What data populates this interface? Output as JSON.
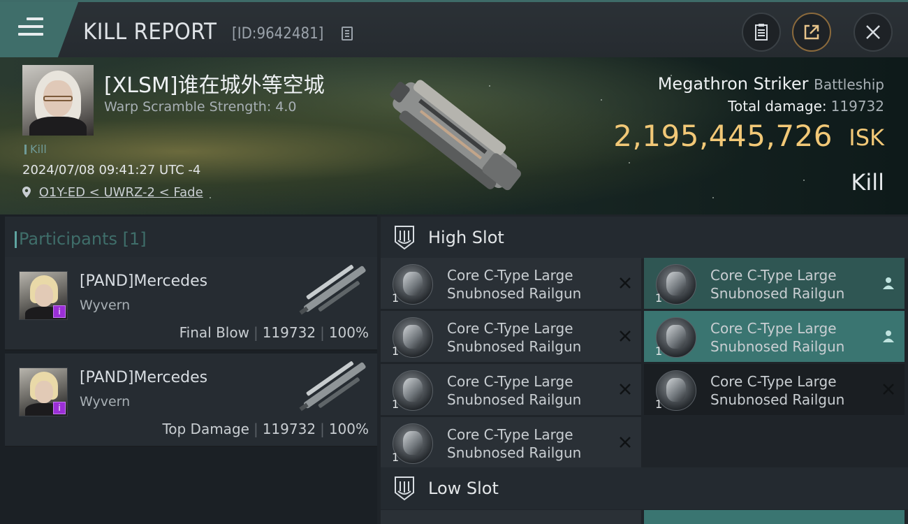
{
  "header": {
    "title": "KILL REPORT",
    "report_id": "[ID:9642481]"
  },
  "victim": {
    "name": "[XLSM]谁在城外等空城",
    "warp_scramble": "Warp Scramble Strength: 4.0",
    "kill_tag": "Kill",
    "datetime": "2024/07/08 09:41:27 UTC -4",
    "location": "O1Y-ED < UWRZ-2 < Fade"
  },
  "ship": {
    "name": "Megathron Striker",
    "class": "Battleship",
    "total_damage_label": "Total damage:",
    "total_damage": "119732",
    "isk_value": "2,195,445,726",
    "isk_unit": "ISK",
    "result": "Kill"
  },
  "participants": {
    "title": "Participants [1]",
    "rows": [
      {
        "name": "[PAND]Mercedes",
        "ship": "Wyvern",
        "role": "Final Blow",
        "damage": "119732",
        "percent": "100%"
      },
      {
        "name": "[PAND]Mercedes",
        "ship": "Wyvern",
        "role": "Top Damage",
        "damage": "119732",
        "percent": "100%"
      }
    ]
  },
  "fitting": {
    "high_slot_title": "High Slot",
    "low_slot_title": "Low Slot",
    "modules": [
      {
        "line1": "Core C-Type Large",
        "line2": "Snubnosed Railgun",
        "qty": "1",
        "status": "destroyed"
      },
      {
        "line1": "Core C-Type Large",
        "line2": "Snubnosed Railgun",
        "qty": "1",
        "status": "dropped"
      },
      {
        "line1": "Core C-Type Large",
        "line2": "Snubnosed Railgun",
        "qty": "1",
        "status": "destroyed"
      },
      {
        "line1": "Core C-Type Large",
        "line2": "Snubnosed Railgun",
        "qty": "1",
        "status": "dropped"
      },
      {
        "line1": "Core C-Type Large",
        "line2": "Snubnosed Railgun",
        "qty": "1",
        "status": "destroyed"
      },
      {
        "line1": "Core C-Type Large",
        "line2": "Snubnosed Railgun",
        "qty": "1",
        "status": "destroyed"
      },
      {
        "line1": "Core C-Type Large",
        "line2": "Snubnosed Railgun",
        "qty": "1",
        "status": "destroyed"
      }
    ]
  },
  "colors": {
    "accent_teal": "#3f6e6a",
    "isk_gold": "#f2c877",
    "dropped_green": "#3a7571"
  },
  "icons": {
    "menu": "hamburger-icon",
    "copy": "copy-icon",
    "clipboard": "clipboard-icon",
    "share": "share-icon",
    "close": "close-icon",
    "location": "map-pin-icon",
    "slot": "slot-icon",
    "destroyed": "x-icon",
    "dropped": "person-icon"
  }
}
